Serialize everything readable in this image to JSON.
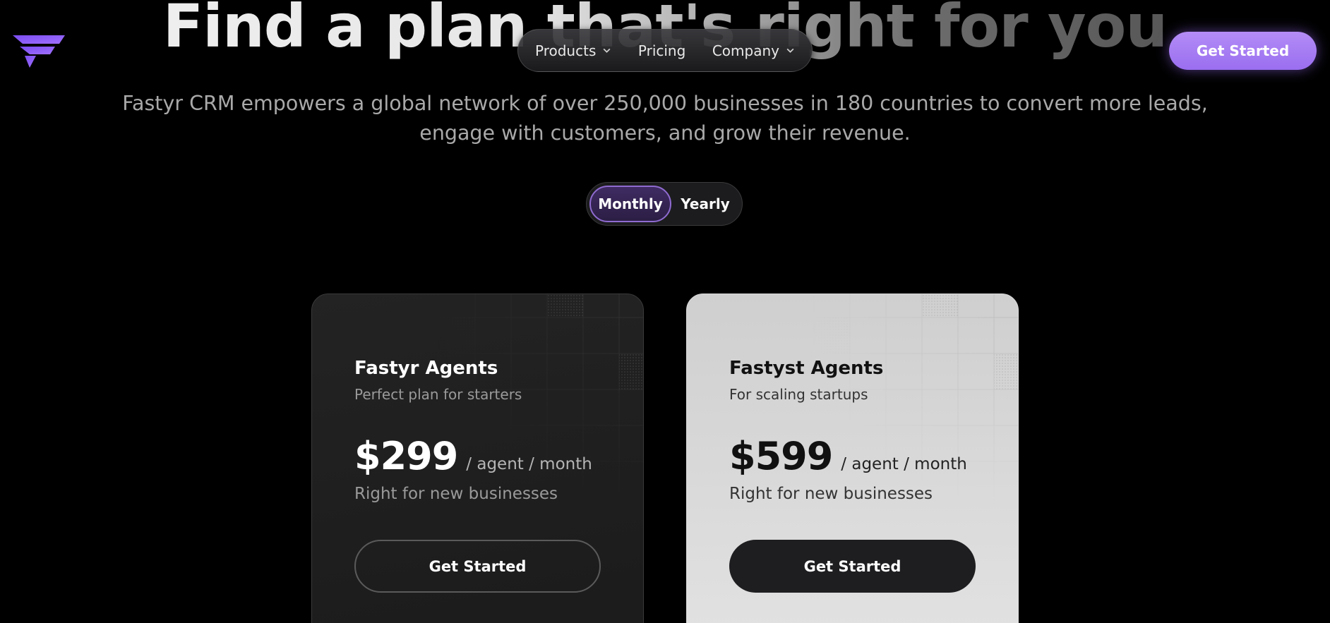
{
  "hero": {
    "title": "Find a plan that's right for you",
    "subtitle": "Fastyr CRM empowers a global network of over 250,000 businesses in 180 countries to convert more leads, engage with customers, and grow their revenue."
  },
  "nav": {
    "products": "Products",
    "pricing": "Pricing",
    "company": "Company"
  },
  "header_cta": "Get Started",
  "billing_toggle": {
    "monthly": "Monthly",
    "yearly": "Yearly",
    "selected": "Monthly"
  },
  "plans": [
    {
      "name": "Fastyr Agents",
      "tagline": "Perfect plan for starters",
      "price": "$299",
      "period": "/ agent / month",
      "description": "Right for new businesses",
      "button": "Get Started"
    },
    {
      "name": "Fastyst Agents",
      "tagline": "For scaling startups",
      "price": "$599",
      "period": "/ agent / month",
      "description": "Right for new businesses",
      "button": "Get Started"
    }
  ],
  "colors": {
    "accent": "#9a6ef0",
    "background": "#000000",
    "dark_card": "#1f1f1f",
    "light_card": "#d9d9d9"
  }
}
